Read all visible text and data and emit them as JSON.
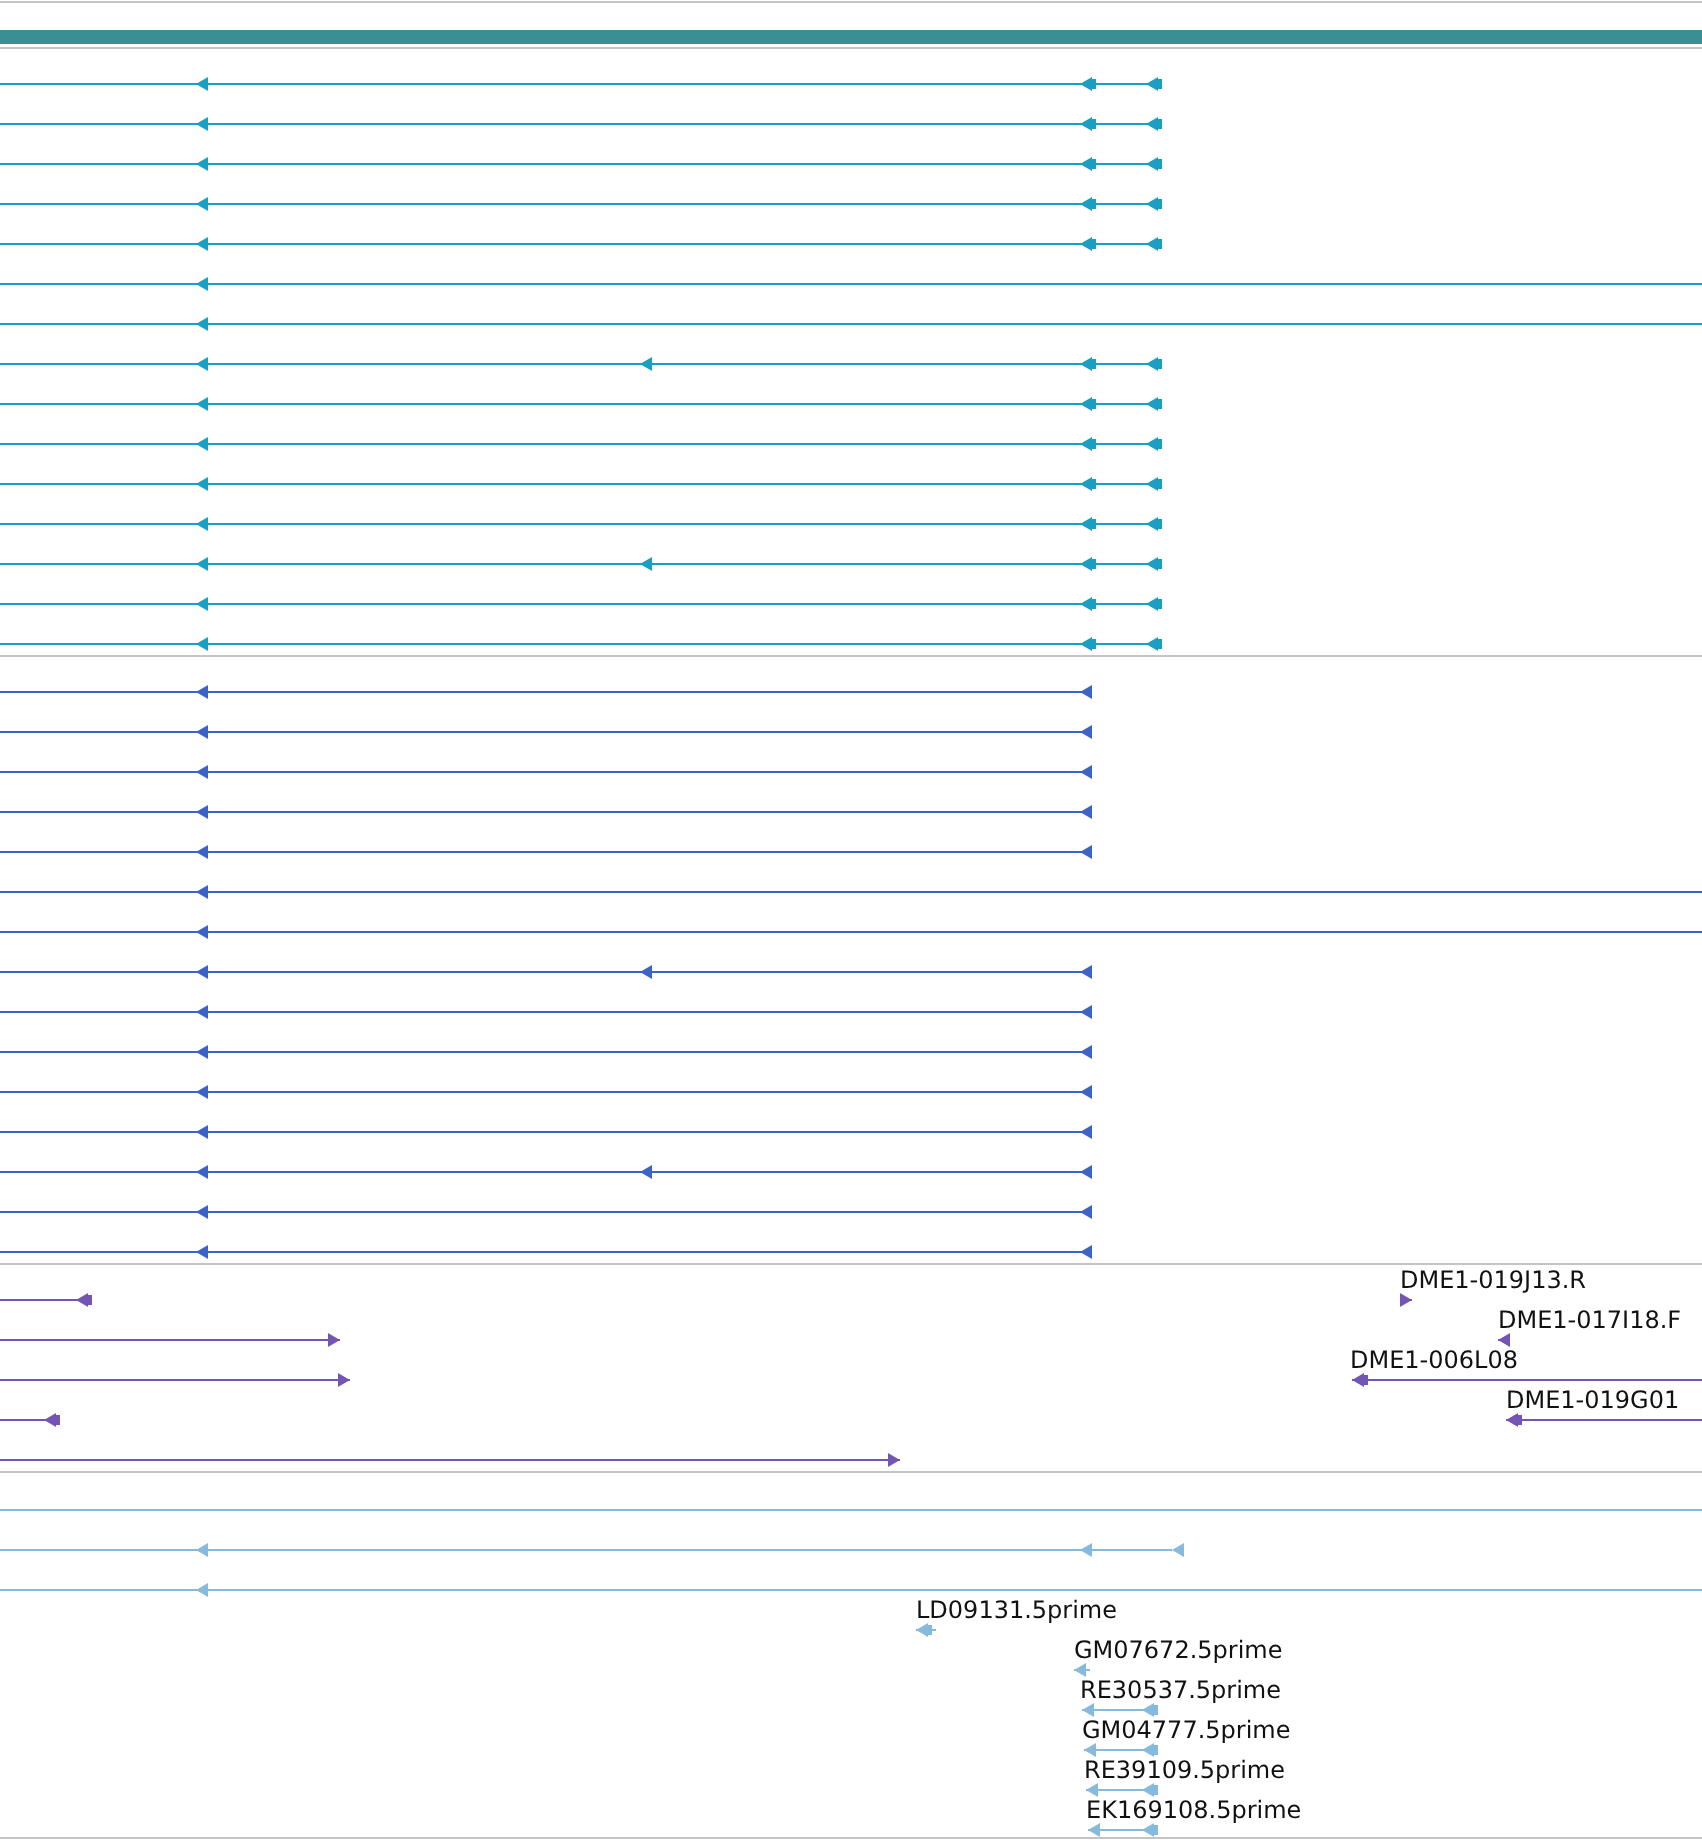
{
  "tracks": [
    {
      "color": "#1a9ec1",
      "features": [
        {
          "kind": "split",
          "reverse": true
        },
        {
          "kind": "split",
          "reverse": true
        },
        {
          "kind": "split",
          "reverse": true
        },
        {
          "kind": "split",
          "reverse": true
        },
        {
          "kind": "split",
          "reverse": true
        },
        {
          "kind": "open",
          "reverse": true
        },
        {
          "kind": "open",
          "reverse": true
        },
        {
          "kind": "extra",
          "reverse": true
        },
        {
          "kind": "split",
          "reverse": true
        },
        {
          "kind": "split",
          "reverse": true
        },
        {
          "kind": "split",
          "reverse": true
        },
        {
          "kind": "split",
          "reverse": true
        },
        {
          "kind": "extra",
          "reverse": true
        },
        {
          "kind": "split",
          "reverse": true
        },
        {
          "kind": "split",
          "reverse": true
        }
      ]
    },
    {
      "color": "#3d63c7",
      "features": [
        {
          "kind": "split",
          "reverse": true
        },
        {
          "kind": "split",
          "reverse": true
        },
        {
          "kind": "split",
          "reverse": true
        },
        {
          "kind": "split",
          "reverse": true
        },
        {
          "kind": "split",
          "reverse": true
        },
        {
          "kind": "open",
          "reverse": true
        },
        {
          "kind": "open",
          "reverse": true
        },
        {
          "kind": "extra",
          "reverse": true
        },
        {
          "kind": "split",
          "reverse": true
        },
        {
          "kind": "split",
          "reverse": true
        },
        {
          "kind": "split",
          "reverse": true
        },
        {
          "kind": "split",
          "reverse": true
        },
        {
          "kind": "extra",
          "reverse": true
        },
        {
          "kind": "split",
          "reverse": true
        },
        {
          "kind": "split",
          "reverse": true
        }
      ]
    },
    {
      "color": "#7454b4",
      "features": [
        {
          "reverse": true
        },
        {
          "reverse": false
        },
        {
          "reverse": false
        },
        {
          "reverse": true
        },
        {
          "reverse": false
        },
        {
          "reverse": false,
          "label": "DME1-019J13.R"
        },
        {
          "reverse": true,
          "label": "DME1-017I18.F"
        },
        {
          "reverse": true,
          "label": "DME1-006L08"
        },
        {
          "reverse": true,
          "label": "DME1-019G01"
        }
      ]
    },
    {
      "color": "#86b9dc",
      "features": [
        {
          "kind": "bare"
        },
        {
          "kind": "read",
          "reverse": true
        },
        {
          "kind": "read",
          "reverse": true
        },
        {
          "kind": "read",
          "reverse": true,
          "label": "LD09131.5prime"
        },
        {
          "kind": "read",
          "reverse": true,
          "label": "GM07672.5prime"
        },
        {
          "kind": "read",
          "reverse": true,
          "label": "RE30537.5prime"
        },
        {
          "kind": "read",
          "reverse": true,
          "label": "GM04777.5prime"
        },
        {
          "kind": "read",
          "reverse": true,
          "label": "RE39109.5prime"
        },
        {
          "kind": "read",
          "reverse": true,
          "label": "EK169108.5prime"
        }
      ]
    }
  ]
}
